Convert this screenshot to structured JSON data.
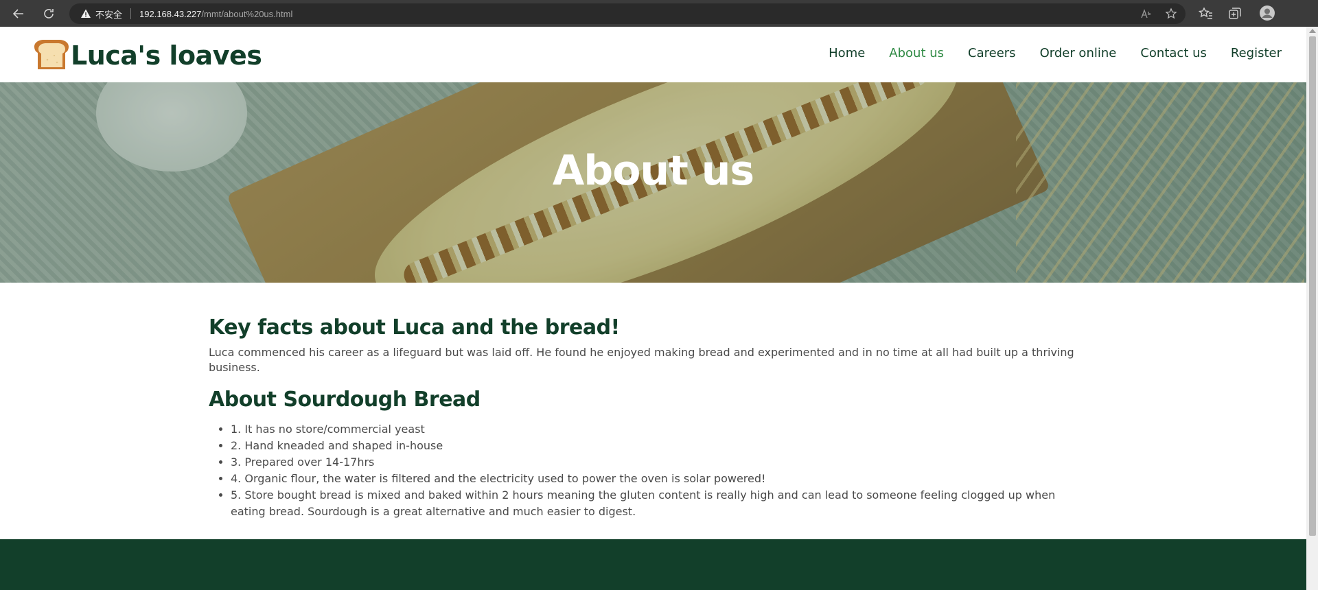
{
  "browser": {
    "security_label": "不安全",
    "url_host": "192.168.43.227",
    "url_path": "/mmt/about%20us.html",
    "icons": [
      "back-icon",
      "refresh-icon",
      "warning-icon",
      "read-aloud-icon",
      "favorite-add-icon",
      "favorites-icon",
      "collections-icon",
      "profile-icon"
    ]
  },
  "header": {
    "logo_text": "Luca's loaves",
    "logo_icon": "bread-loaf-icon",
    "brand_color": "#123f2a",
    "active_color": "#2f8a44",
    "nav": [
      {
        "label": "Home",
        "active": false
      },
      {
        "label": "About us",
        "active": true
      },
      {
        "label": "Careers",
        "active": false
      },
      {
        "label": "Order online",
        "active": false
      },
      {
        "label": "Contact us",
        "active": false
      },
      {
        "label": "Register",
        "active": false
      }
    ]
  },
  "hero": {
    "title": "About us"
  },
  "content": {
    "heading1": "Key facts about Luca and the bread!",
    "paragraph1": "Luca commenced his career as a lifeguard but was laid off. He found he enjoyed making bread and experimented and in no time at all had built up a thriving business.",
    "heading2": "About Sourdough Bread",
    "facts": [
      "1. It has no store/commercial yeast",
      "2. Hand kneaded and shaped in-house",
      "3. Prepared over 14-17hrs",
      "4. Organic flour, the water is filtered and the electricity used to power the oven is solar powered!",
      "5. Store bought bread is mixed and baked within 2 hours meaning the gluten content is really high and can lead to someone feeling clogged up when eating bread. Sourdough is a great alternative and much easier to digest."
    ]
  },
  "footer": {
    "color": "#123f2a"
  }
}
